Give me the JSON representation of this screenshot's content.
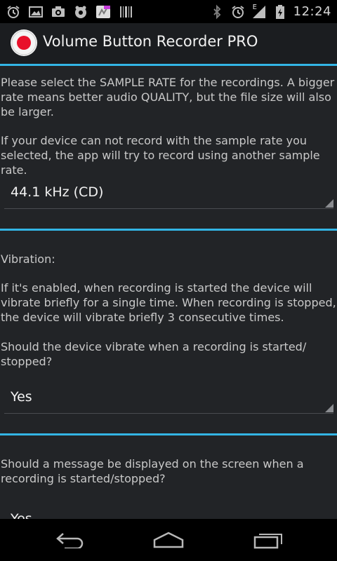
{
  "statusbar": {
    "time": "12:24",
    "network_label": "E",
    "left_icons": [
      "alarm-icon",
      "image-icon",
      "camera-icon",
      "settings-app-icon",
      "recorder-pro-icon",
      "barcode-icon"
    ],
    "right_icons": [
      "bluetooth-icon",
      "alarm-icon",
      "signal-icon",
      "battery-icon"
    ]
  },
  "actionbar": {
    "title": "Volume Button Recorder PRO"
  },
  "sections": {
    "sample_rate": {
      "text1": "Please select the SAMPLE RATE for the recordings. A bigger rate means better audio QUALITY, but the file size will also be larger.",
      "text2": "If your device can not record with the sample rate you selected, the app will try to record using another sample rate.",
      "spinner_value": "44.1 kHz (CD)"
    },
    "vibration": {
      "heading": "Vibration:",
      "text1": "If it's enabled, when recording is started the device will vibrate briefly for a single time. When recording is stopped, the device will vibrate briefly 3 consecutive times.",
      "text2": "Should the device vibrate when a recording is started/ stopped?",
      "spinner_value": "Yes"
    },
    "message": {
      "text1": "Should a message be displayed on the screen when a recording is started/stopped?",
      "spinner_value": "Yes"
    }
  },
  "colors": {
    "accent": "#33b5e5",
    "content_bg": "#222427",
    "actionbar_bg": "#1b1d20",
    "record_red": "#e8102a"
  },
  "navbar": {
    "buttons": [
      "back-icon",
      "home-icon",
      "recent-apps-icon"
    ]
  }
}
